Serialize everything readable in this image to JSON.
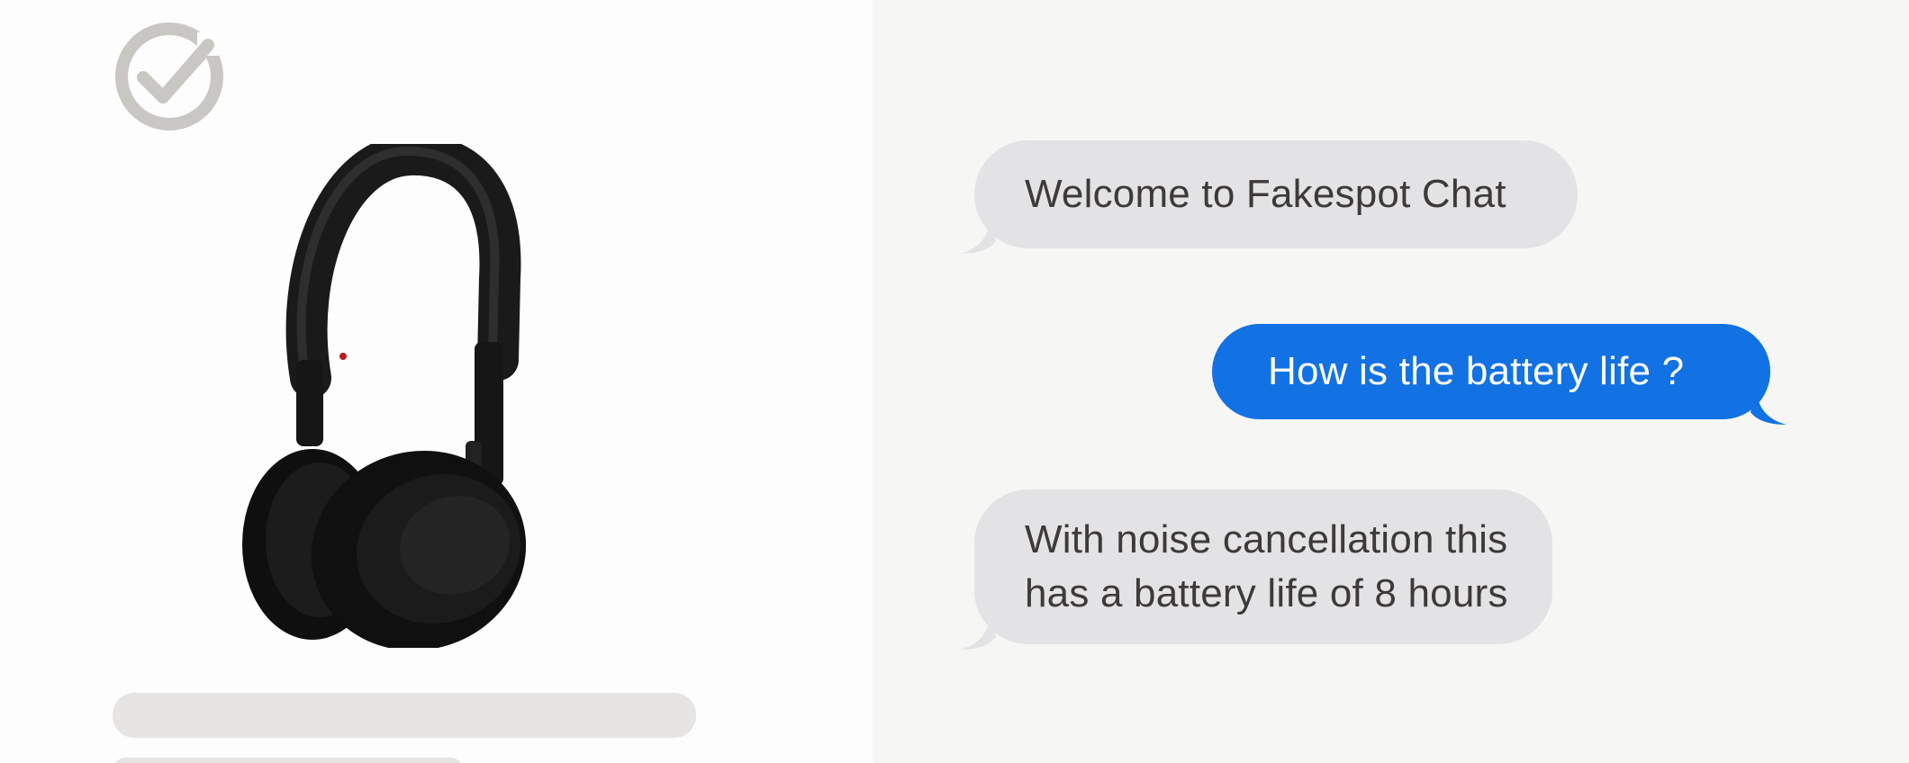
{
  "product_panel": {
    "badge_icon": "checkmark-circle-icon",
    "product_image_icon": "headphones-icon",
    "colors": {
      "badge": "#c9c7c3",
      "placeholder": "#e6e5e4",
      "headphones": "#141414"
    }
  },
  "chat": {
    "messages": [
      {
        "sender": "bot",
        "text": "Welcome to Fakespot Chat"
      },
      {
        "sender": "user",
        "text": "How is the battery life ?"
      },
      {
        "sender": "bot",
        "text": "With noise cancellation this\nhas a battery life of 8 hours"
      }
    ],
    "colors": {
      "incoming_bubble": "#e3e2e4",
      "outgoing_bubble": "#1272e3",
      "incoming_text": "#3e3a3a",
      "outgoing_text": "#ffffff"
    }
  }
}
